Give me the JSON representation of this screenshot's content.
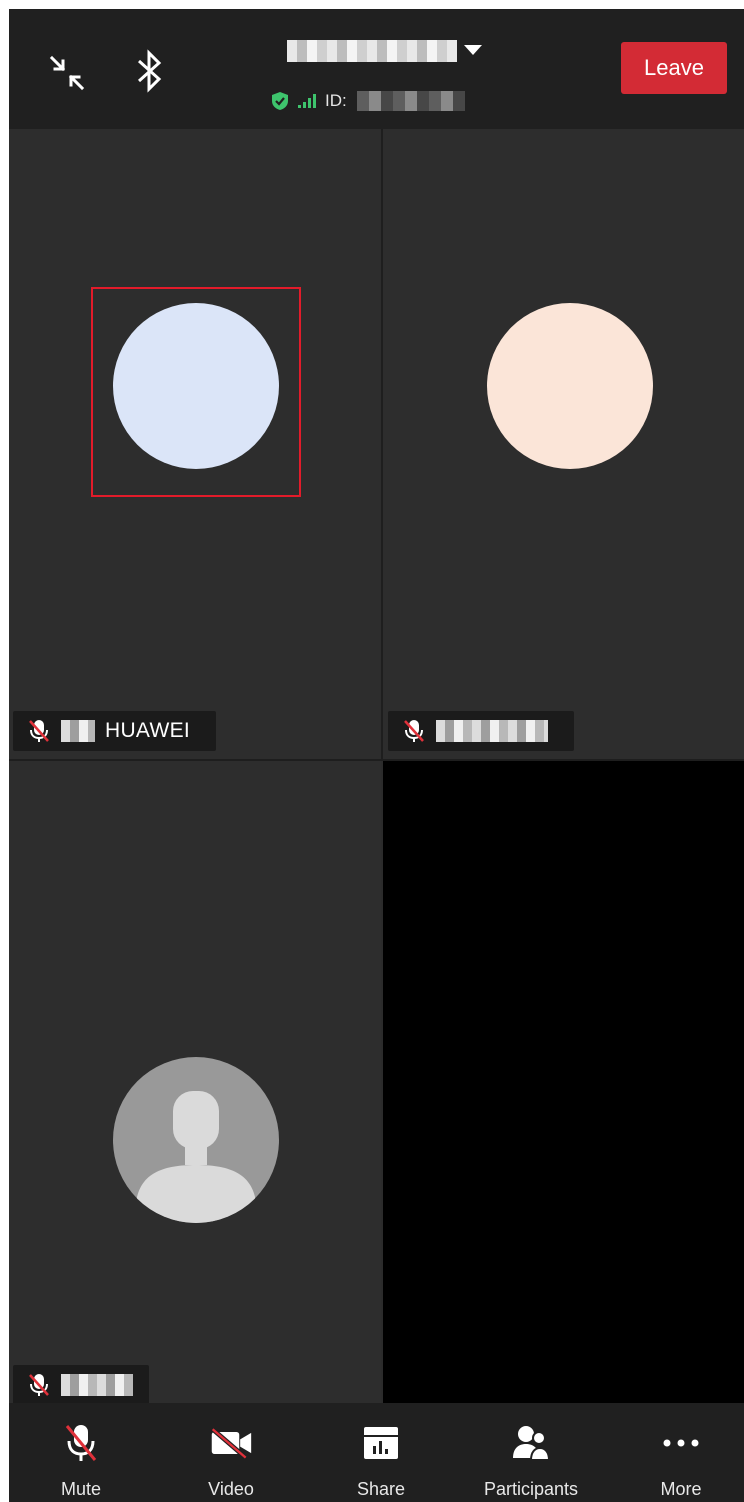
{
  "header": {
    "meeting_id_label": "ID:",
    "leave_label": "Leave"
  },
  "tiles": [
    {
      "name": "HUAWEI",
      "avatar_color": "#dbe5f8",
      "muted": true,
      "highlighted": true
    },
    {
      "name": "",
      "avatar_color": "#fbe5d8",
      "muted": true
    },
    {
      "name": "",
      "avatar_icon": "person-silhouette-icon",
      "muted": true
    },
    {
      "name": "",
      "video": "black"
    }
  ],
  "toolbar": {
    "items": [
      {
        "label": "Mute",
        "icon": "microphone-muted-icon"
      },
      {
        "label": "Video",
        "icon": "video-off-icon"
      },
      {
        "label": "Share",
        "icon": "share-screen-icon"
      },
      {
        "label": "Participants",
        "icon": "participants-icon"
      },
      {
        "label": "More",
        "icon": "more-dots-icon"
      }
    ]
  },
  "colors": {
    "leave": "#d32b35",
    "highlight_box": "#e21b2a",
    "secure_shield": "#3ec46d",
    "mute_slash": "#e0313a"
  }
}
